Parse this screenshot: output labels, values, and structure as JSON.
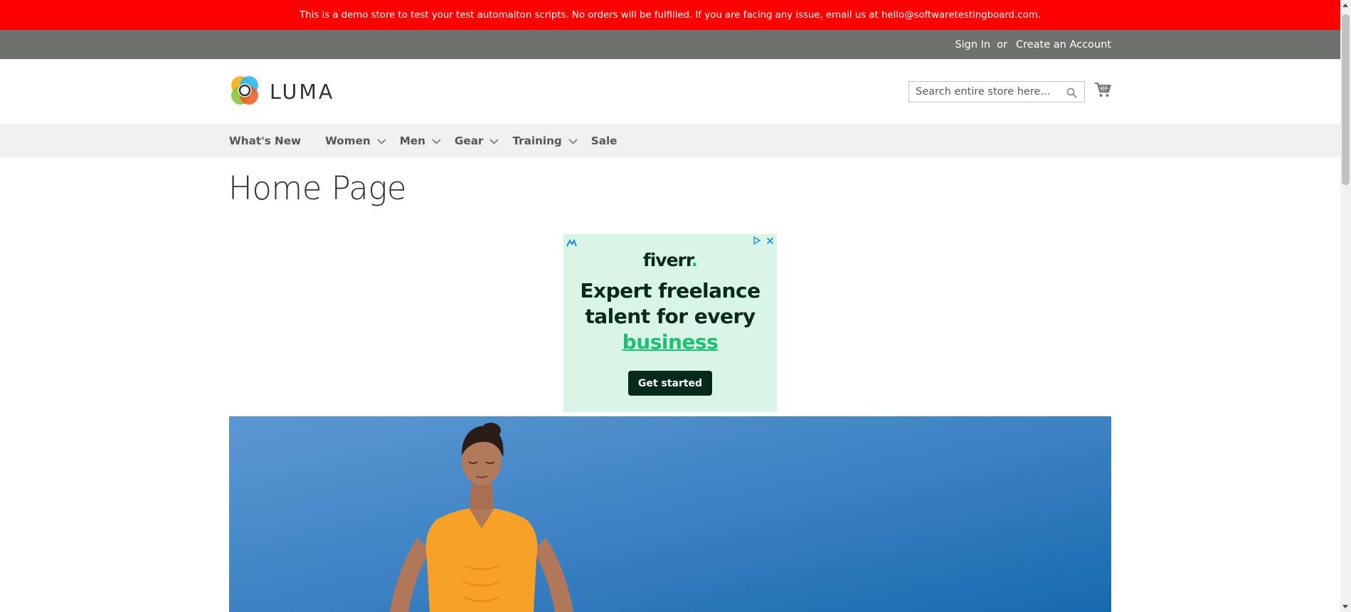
{
  "banner": {
    "text": "This is a demo store to test your test automaiton scripts. No orders will be fulfilled. If you are facing any issue, email us at hello@softwaretestingboard.com."
  },
  "header_links": {
    "sign_in": "Sign In",
    "separator": "or",
    "create_account": "Create an Account"
  },
  "logo": {
    "text": "LUMA"
  },
  "search": {
    "placeholder": "Search entire store here...",
    "value": ""
  },
  "nav": {
    "items": [
      {
        "label": "What's New"
      },
      {
        "label": "Women"
      },
      {
        "label": "Men"
      },
      {
        "label": "Gear"
      },
      {
        "label": "Training"
      },
      {
        "label": "Sale"
      }
    ]
  },
  "page": {
    "title": "Home Page"
  },
  "ad": {
    "brand": "fiverr",
    "brand_dot": ".",
    "headline_line1": "Expert freelance",
    "headline_line2": "talent for every",
    "headline_accent": "business",
    "cta": "Get started"
  },
  "colors": {
    "banner_bg": "#ff0000",
    "panel_bg": "#6e716e",
    "nav_bg": "#f0f0f0",
    "ad_bg": "#d9f5e7",
    "ad_accent": "#1dbf73",
    "ad_dark": "#062b1a"
  },
  "icons": {
    "logo_mark": "luma-logo-icon",
    "search": "search-icon",
    "cart": "cart-icon",
    "nav_chevron": "chevron-down-icon"
  }
}
